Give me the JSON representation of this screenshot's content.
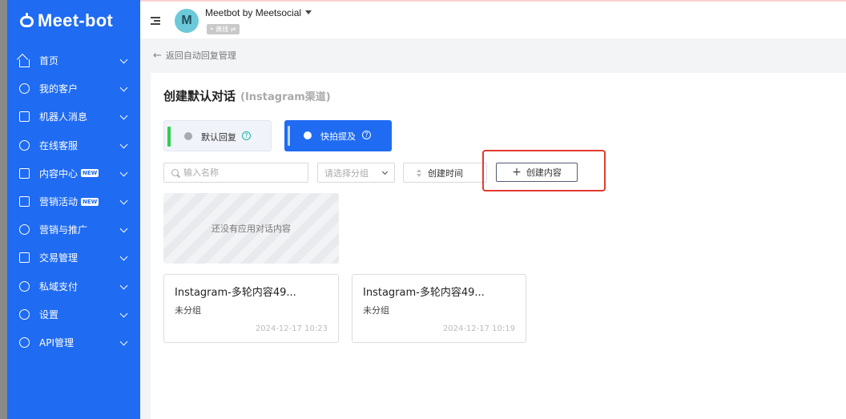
{
  "sidebar": {
    "logo": "Meet-bot",
    "items": [
      {
        "label": "首页",
        "icon": "home-icon"
      },
      {
        "label": "我的客户",
        "icon": "customers-icon"
      },
      {
        "label": "机器人消息",
        "icon": "chat-icon"
      },
      {
        "label": "在线客服",
        "icon": "headset-icon"
      },
      {
        "label": "内容中心",
        "icon": "content-icon",
        "badge": "NEW"
      },
      {
        "label": "营销活动",
        "icon": "megaphone-icon",
        "badge": "NEW"
      },
      {
        "label": "营销与推广",
        "icon": "send-icon"
      },
      {
        "label": "交易管理",
        "icon": "bag-icon"
      },
      {
        "label": "私域支付",
        "icon": "payment-icon"
      },
      {
        "label": "设置",
        "icon": "gear-icon"
      },
      {
        "label": "API管理",
        "icon": "api-icon"
      }
    ]
  },
  "header": {
    "avatar_letter": "M",
    "account_name": "Meetbot by Meetsocial",
    "status": "• 离线 ⇄"
  },
  "back_link": "返回自动回复管理",
  "page": {
    "title": "创建默认对话",
    "subtitle": "(Instagram渠道)"
  },
  "tabs": [
    {
      "label": "默认回复",
      "help": "?"
    },
    {
      "label": "快拍提及",
      "help": "?"
    }
  ],
  "filters": {
    "search_placeholder": "输入名称",
    "group_placeholder": "请选择分组",
    "sort_label": "创建时间",
    "create_label": "创建内容"
  },
  "empty_text": "还没有应用对话内容",
  "cards": [
    {
      "title": "Instagram-多轮内容49...",
      "group": "未分组",
      "time": "2024-12-17 10:23"
    },
    {
      "title": "Instagram-多轮内容49...",
      "group": "未分组",
      "time": "2024-12-17 10:19"
    }
  ],
  "colors": {
    "sidebar_bg": "#1f6bf2",
    "active_tab": "#1f6bf2",
    "highlight": "#e33a2f",
    "default_bar": "#2fcf4d"
  }
}
